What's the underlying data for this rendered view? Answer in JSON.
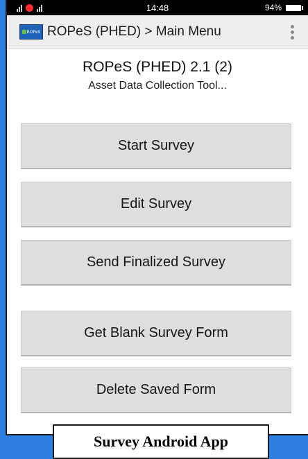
{
  "status_bar": {
    "time": "14:48",
    "battery": "94%"
  },
  "action_bar": {
    "logo_text": "ROPeS",
    "title": "ROPeS (PHED) > Main Menu"
  },
  "header": {
    "title": "ROPeS (PHED) 2.1 (2)",
    "subtitle": "Asset Data Collection Tool..."
  },
  "menu": {
    "start_survey": "Start Survey",
    "edit_survey": "Edit Survey",
    "send_finalized": "Send Finalized Survey",
    "get_blank_form": "Get Blank Survey Form",
    "delete_saved": "Delete Saved Form"
  },
  "caption": "Survey Android App",
  "colors": {
    "background": "#2f7fe0",
    "button": "#dedede",
    "action_bar": "#eeeeee"
  }
}
